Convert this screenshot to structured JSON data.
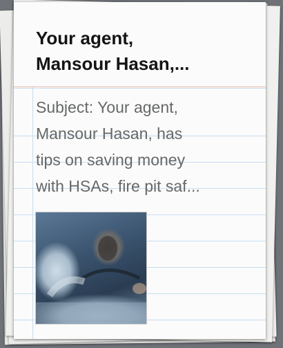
{
  "note": {
    "title": "Your agent,\nMansour Hasan,...",
    "snippet": "Subject: Your agent,\nMansour Hasan, has\ntips on saving money\nwith HSAs, fire pit saf..."
  },
  "colors": {
    "background": "#6f7378",
    "paper": "#fbfbfb",
    "ruled_line": "#c6def0",
    "title_rule": "#efb8a9",
    "title_text": "#141414",
    "snippet_text": "#666868"
  }
}
